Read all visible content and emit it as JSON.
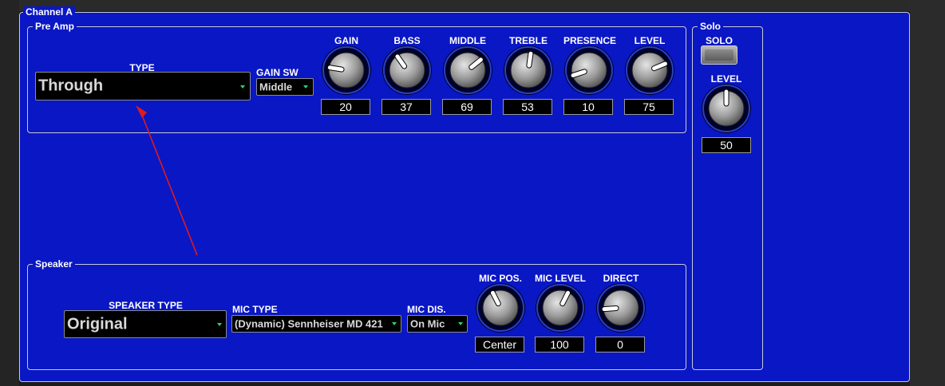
{
  "channel": {
    "title": "Channel A"
  },
  "preamp": {
    "title": "Pre Amp",
    "type_label": "TYPE",
    "type_value": "Through",
    "gain_sw_label": "GAIN SW",
    "gain_sw_value": "Middle",
    "knobs": [
      {
        "label": "GAIN",
        "value": "20"
      },
      {
        "label": "BASS",
        "value": "37"
      },
      {
        "label": "MIDDLE",
        "value": "69"
      },
      {
        "label": "TREBLE",
        "value": "53"
      },
      {
        "label": "PRESENCE",
        "value": "10"
      },
      {
        "label": "LEVEL",
        "value": "75"
      }
    ]
  },
  "speaker": {
    "title": "Speaker",
    "speaker_type_label": "SPEAKER TYPE",
    "speaker_type_value": "Original",
    "mic_type_label": "MIC TYPE",
    "mic_type_value": "(Dynamic) Sennheiser MD 421",
    "mic_dis_label": "MIC DIS.",
    "mic_dis_value": "On Mic",
    "knobs": [
      {
        "label": "MIC POS.",
        "value": "Center"
      },
      {
        "label": "MIC LEVEL",
        "value": "100"
      },
      {
        "label": "DIRECT",
        "value": "0"
      }
    ]
  },
  "solo": {
    "title": "Solo",
    "solo_label": "SOLO",
    "level_label": "LEVEL",
    "level_value": "50"
  },
  "knob_levels": {
    "gain": 0.2,
    "bass": 0.37,
    "middle": 0.69,
    "treble": 0.53,
    "presence": 0.1,
    "level": 0.75,
    "mic_pos": 0.4,
    "mic_level": 0.6,
    "direct": 0.15,
    "solo_level": 0.5
  },
  "colors": {
    "panel": "#0a17c4",
    "accent": "#2bd36b",
    "arrow": "#e01b1b"
  }
}
